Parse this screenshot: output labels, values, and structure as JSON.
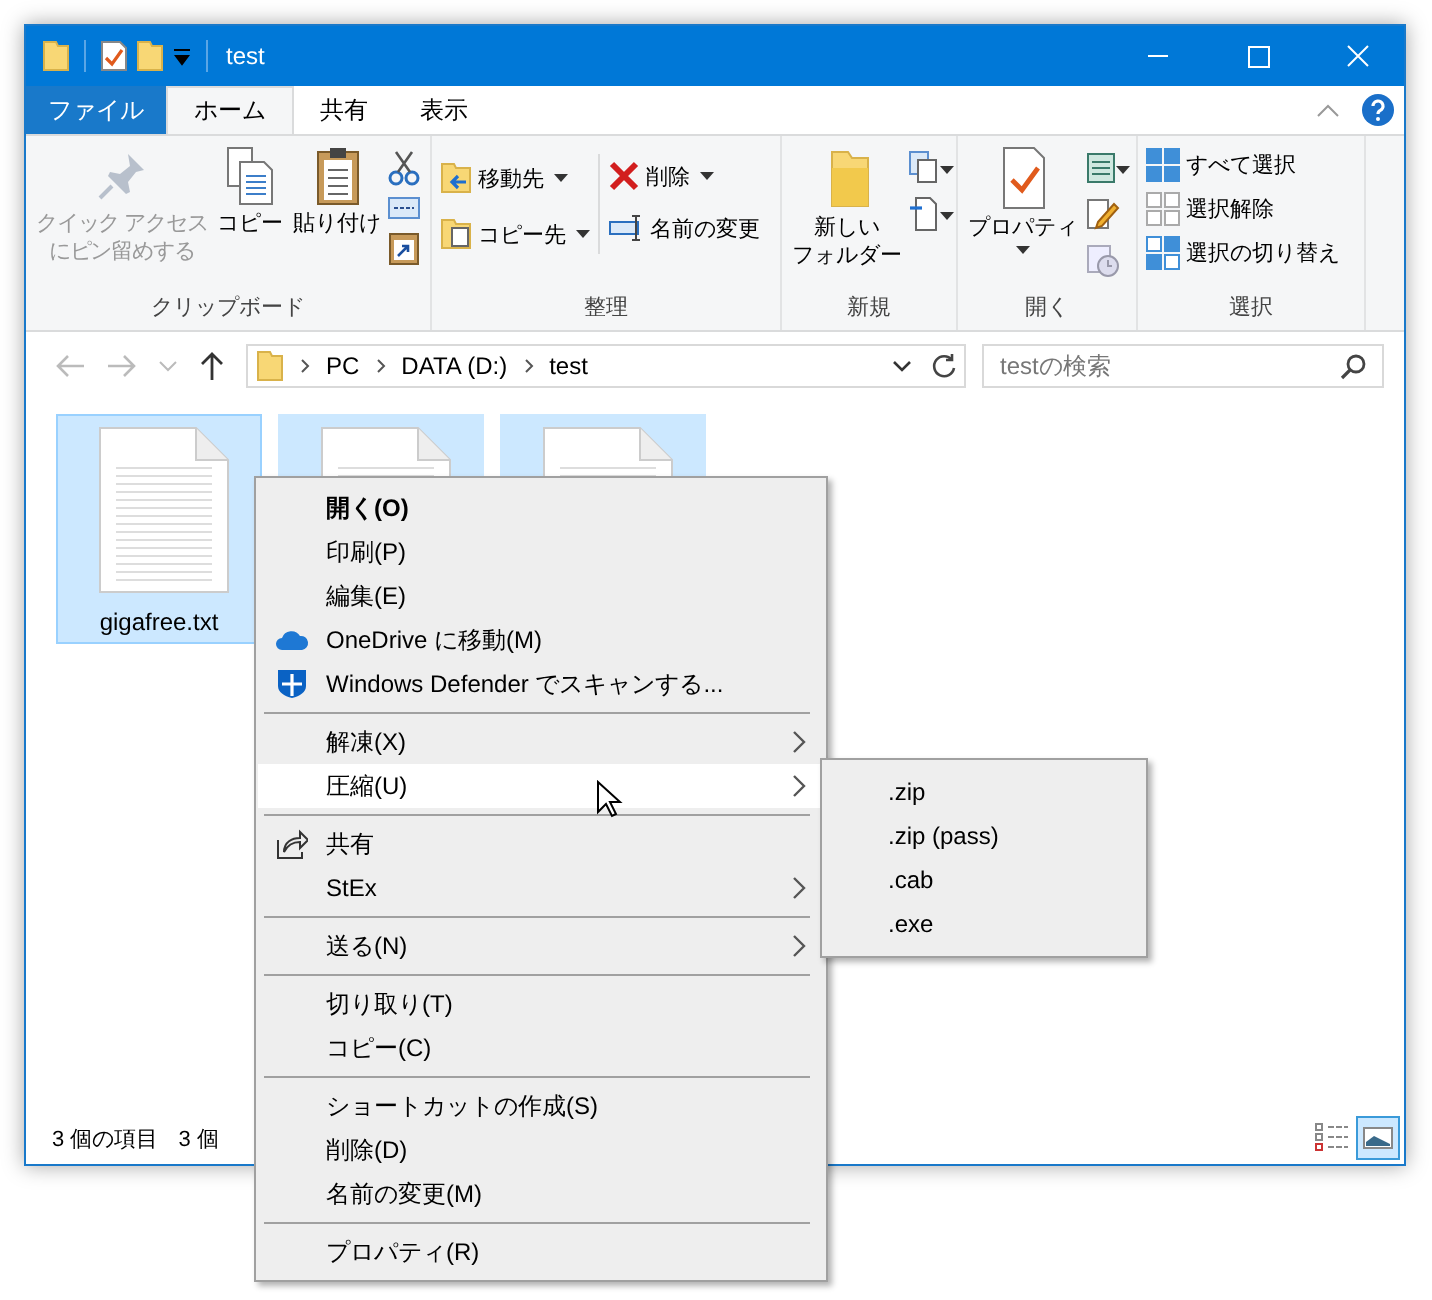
{
  "window": {
    "title": "test"
  },
  "ribbon_tabs": [
    {
      "label": "ファイル",
      "kind": "file",
      "selected": false
    },
    {
      "label": "ホーム",
      "kind": "tab",
      "selected": true
    },
    {
      "label": "共有",
      "kind": "tab",
      "selected": false
    },
    {
      "label": "表示",
      "kind": "tab",
      "selected": false
    }
  ],
  "ribbon_groups": [
    {
      "label": "クリップボード",
      "kind": "clipboard",
      "buttons": [
        {
          "lines": [
            "クイック アクセス",
            "にピン留めする"
          ],
          "disabled": true
        },
        {
          "lines": [
            "コピー"
          ],
          "disabled": false
        },
        {
          "lines": [
            "貼り付け"
          ],
          "disabled": false
        }
      ]
    },
    {
      "label": "整理",
      "kind": "organize",
      "buttons": [
        {
          "lines": [
            "移動先"
          ],
          "dropdown": true
        },
        {
          "lines": [
            "コピー先"
          ],
          "dropdown": true
        },
        {
          "lines": [
            "削除"
          ],
          "dropdown": true
        },
        {
          "lines": [
            "名前の変更"
          ],
          "dropdown": false
        }
      ]
    },
    {
      "label": "新規",
      "kind": "new",
      "buttons": [
        {
          "lines": [
            "新しい",
            "フォルダー"
          ]
        }
      ]
    },
    {
      "label": "開く",
      "kind": "open",
      "buttons": [
        {
          "lines": [
            "プロパティ"
          ]
        }
      ]
    },
    {
      "label": "選択",
      "kind": "select",
      "buttons": [
        {
          "lines": [
            "すべて選択"
          ]
        },
        {
          "lines": [
            "選択解除"
          ]
        },
        {
          "lines": [
            "選択の切り替え"
          ]
        }
      ]
    }
  ],
  "address": {
    "path": [
      "PC",
      "DATA (D:)",
      "test"
    ]
  },
  "search": {
    "placeholder": "testの検索"
  },
  "files": [
    {
      "name": "gigafree.txt",
      "selected": true,
      "focused": true
    },
    {
      "selected": true,
      "focused": false
    },
    {
      "selected": true,
      "focused": false
    }
  ],
  "status_bar": [
    "3 個の項目",
    "3 個"
  ],
  "context_menu": [
    {
      "kind": "item",
      "label": "開く(O)",
      "bold": true,
      "submenu": false,
      "highlighted": false
    },
    {
      "kind": "item",
      "label": "印刷(P)",
      "bold": false,
      "submenu": false,
      "highlighted": false
    },
    {
      "kind": "item",
      "label": "編集(E)",
      "bold": false,
      "submenu": false,
      "highlighted": false
    },
    {
      "kind": "cloud",
      "label": "OneDrive に移動(M)",
      "bold": false,
      "submenu": false,
      "highlighted": false
    },
    {
      "kind": "shield",
      "label": "Windows Defender でスキャンする...",
      "bold": false,
      "submenu": false,
      "highlighted": false
    },
    {
      "kind": "separator"
    },
    {
      "kind": "item",
      "label": "解凍(X)",
      "bold": false,
      "submenu": true,
      "highlighted": false
    },
    {
      "kind": "item",
      "label": "圧縮(U)",
      "bold": false,
      "submenu": true,
      "highlighted": true
    },
    {
      "kind": "separator"
    },
    {
      "kind": "share",
      "label": "共有",
      "bold": false,
      "submenu": false,
      "highlighted": false
    },
    {
      "kind": "item",
      "label": "StEx",
      "bold": false,
      "submenu": true,
      "highlighted": false
    },
    {
      "kind": "separator"
    },
    {
      "kind": "item",
      "label": "送る(N)",
      "bold": false,
      "submenu": true,
      "highlighted": false
    },
    {
      "kind": "separator"
    },
    {
      "kind": "item",
      "label": "切り取り(T)",
      "bold": false,
      "submenu": false,
      "highlighted": false
    },
    {
      "kind": "item",
      "label": "コピー(C)",
      "bold": false,
      "submenu": false,
      "highlighted": false
    },
    {
      "kind": "separator"
    },
    {
      "kind": "item",
      "label": "ショートカットの作成(S)",
      "bold": false,
      "submenu": false,
      "highlighted": false
    },
    {
      "kind": "item",
      "label": "削除(D)",
      "bold": false,
      "submenu": false,
      "highlighted": false
    },
    {
      "kind": "item",
      "label": "名前の変更(M)",
      "bold": false,
      "submenu": false,
      "highlighted": false
    },
    {
      "kind": "separator"
    },
    {
      "kind": "item",
      "label": "プロパティ(R)",
      "bold": false,
      "submenu": false,
      "highlighted": false
    }
  ],
  "submenu": [
    {
      "label": ".zip"
    },
    {
      "label": ".zip (pass)"
    },
    {
      "label": ".cab"
    },
    {
      "label": ".exe"
    }
  ]
}
